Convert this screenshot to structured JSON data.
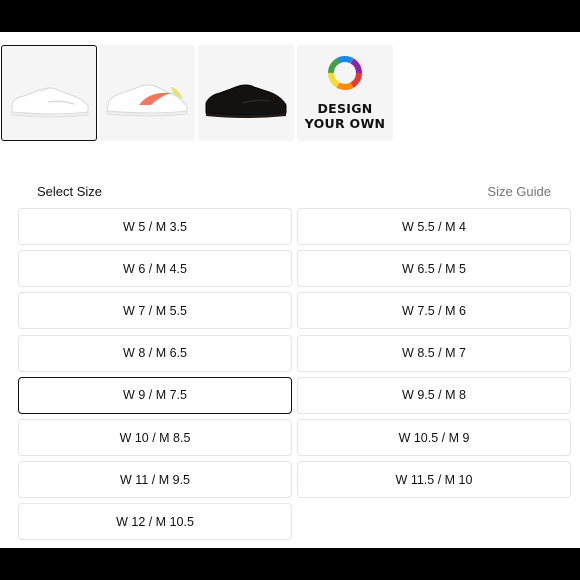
{
  "thumbnails": [
    {
      "icon": "white-sneaker-icon",
      "selected": true
    },
    {
      "icon": "white-pink-sneaker-icon",
      "selected": false
    },
    {
      "icon": "black-sneaker-icon",
      "selected": false
    },
    {
      "icon": "color-wheel-icon",
      "label_lines": [
        "DESIGN",
        "YOUR OWN"
      ],
      "selected": false
    }
  ],
  "size_section": {
    "title": "Select Size",
    "guide_link": "Size Guide",
    "selected": "W 9 / M 7.5",
    "sizes": [
      "W 5 / M 3.5",
      "W 5.5 / M 4",
      "W 6 / M 4.5",
      "W 6.5 / M 5",
      "W 7 / M 5.5",
      "W 7.5 / M 6",
      "W 8 / M 6.5",
      "W 8.5 / M 7",
      "W 9 / M 7.5",
      "W 9.5 / M 8",
      "W 10 / M 8.5",
      "W 10.5 / M 9",
      "W 11 / M 9.5",
      "W 11.5 / M 10",
      "W 12 / M 10.5"
    ]
  },
  "colors": {
    "selected_border": "#111111",
    "button_border": "#e5e5e5",
    "thumb_bg": "#f5f5f5",
    "swoosh_pink": "#f2775d",
    "accent_yellow": "#e8e27a"
  }
}
